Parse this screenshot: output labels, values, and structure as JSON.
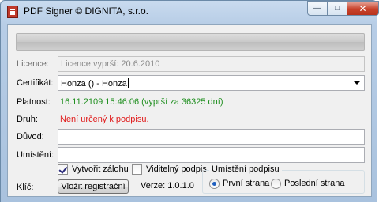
{
  "window": {
    "title": "PDF Signer   © DIGNITA, s.r.o.",
    "close_glyph": "✕",
    "minimize_glyph": "—",
    "maximize_glyph": "□"
  },
  "progress": {
    "value_percent": 0
  },
  "licence": {
    "label": "Licence:",
    "value": "Licence vyprší: 20.6.2010"
  },
  "certificate": {
    "label": "Certifikát:",
    "selected": "Honza () - Honza"
  },
  "validity": {
    "label": "Platnost:",
    "value": "16.11.2109 15:46:06 (vyprší za 36325 dní)",
    "color": "#1f8f1f"
  },
  "kind": {
    "label": "Druh:",
    "value": "Není určený k podpisu.",
    "color": "#e01b1b"
  },
  "reason": {
    "label": "Důvod:",
    "value": ""
  },
  "location": {
    "label": "Umístění:",
    "value": ""
  },
  "options": {
    "backup_label": "Vytvořit zálohu",
    "backup_checked": true,
    "visible_label": "Viditelný podpis",
    "visible_checked": false
  },
  "key": {
    "label": "Klíč:",
    "register_button": "Vložit registrační",
    "version": "Verze: 1.0.1.0"
  },
  "placement": {
    "title": "Umístění podpisu",
    "first_page": "První strana",
    "last_page": "Poslední strana",
    "selected": "first_page"
  }
}
